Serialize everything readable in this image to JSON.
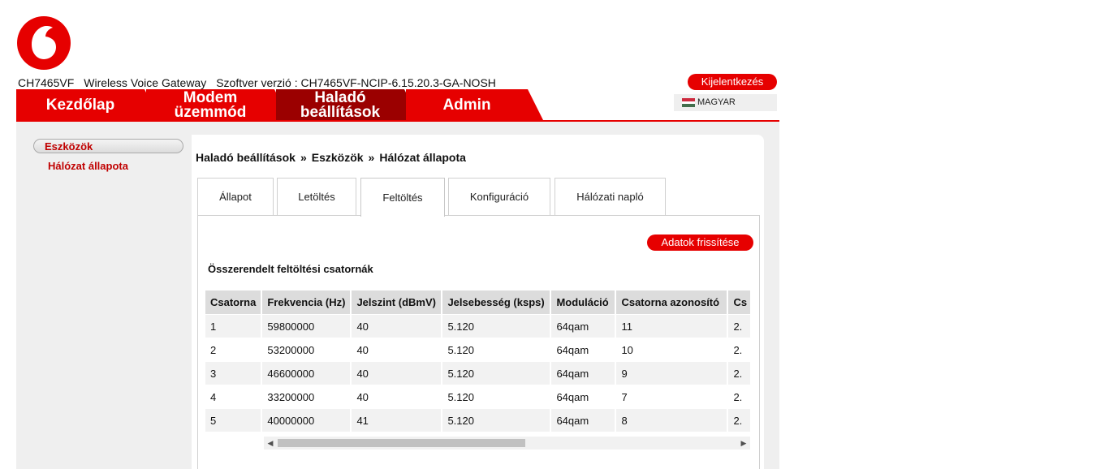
{
  "header": {
    "model": "CH7465VF",
    "device_type": "Wireless Voice Gateway",
    "software_version": "Szoftver verzió : CH7465VF-NCIP-6.15.20.3-GA-NOSH",
    "logout_label": "Kijelentkezés",
    "language_label": "MAGYAR",
    "brand_color": "#e60000"
  },
  "nav": {
    "tabs": [
      {
        "label": "Kezdőlap"
      },
      {
        "label": "Modem üzemmód"
      },
      {
        "label": "Haladó beállítások",
        "active": true
      },
      {
        "label": "Admin"
      }
    ]
  },
  "sidebar": {
    "group_label": "Eszközök",
    "items": [
      {
        "label": "Hálózat állapota"
      }
    ]
  },
  "breadcrumb": {
    "part1": "Haladó beállítások",
    "part2": "Eszközök",
    "part3": "Hálózat állapota",
    "separator": "»"
  },
  "subtabs": [
    {
      "label": "Állapot"
    },
    {
      "label": "Letöltés"
    },
    {
      "label": "Feltöltés",
      "active": true
    },
    {
      "label": "Konfiguráció"
    },
    {
      "label": "Hálózati napló"
    }
  ],
  "panel": {
    "refresh_label": "Adatok frissítése",
    "section_title": "Összerendelt feltöltési csatornák"
  },
  "table": {
    "headers": [
      "Csatorna",
      "Frekvencia (Hz)",
      "Jelszint (dBmV)",
      "Jelsebesség (ksps)",
      "Moduláció",
      "Csatorna azonosító",
      "Cs"
    ],
    "rows": [
      [
        "1",
        "59800000",
        "40",
        "5.120",
        "64qam",
        "11",
        "2."
      ],
      [
        "2",
        "53200000",
        "40",
        "5.120",
        "64qam",
        "10",
        "2."
      ],
      [
        "3",
        "46600000",
        "40",
        "5.120",
        "64qam",
        "9",
        "2."
      ],
      [
        "4",
        "33200000",
        "40",
        "5.120",
        "64qam",
        "7",
        "2."
      ],
      [
        "5",
        "40000000",
        "41",
        "5.120",
        "64qam",
        "8",
        "2."
      ]
    ]
  },
  "scrollbar": {
    "left_arrow": "◀",
    "right_arrow": "▶"
  }
}
